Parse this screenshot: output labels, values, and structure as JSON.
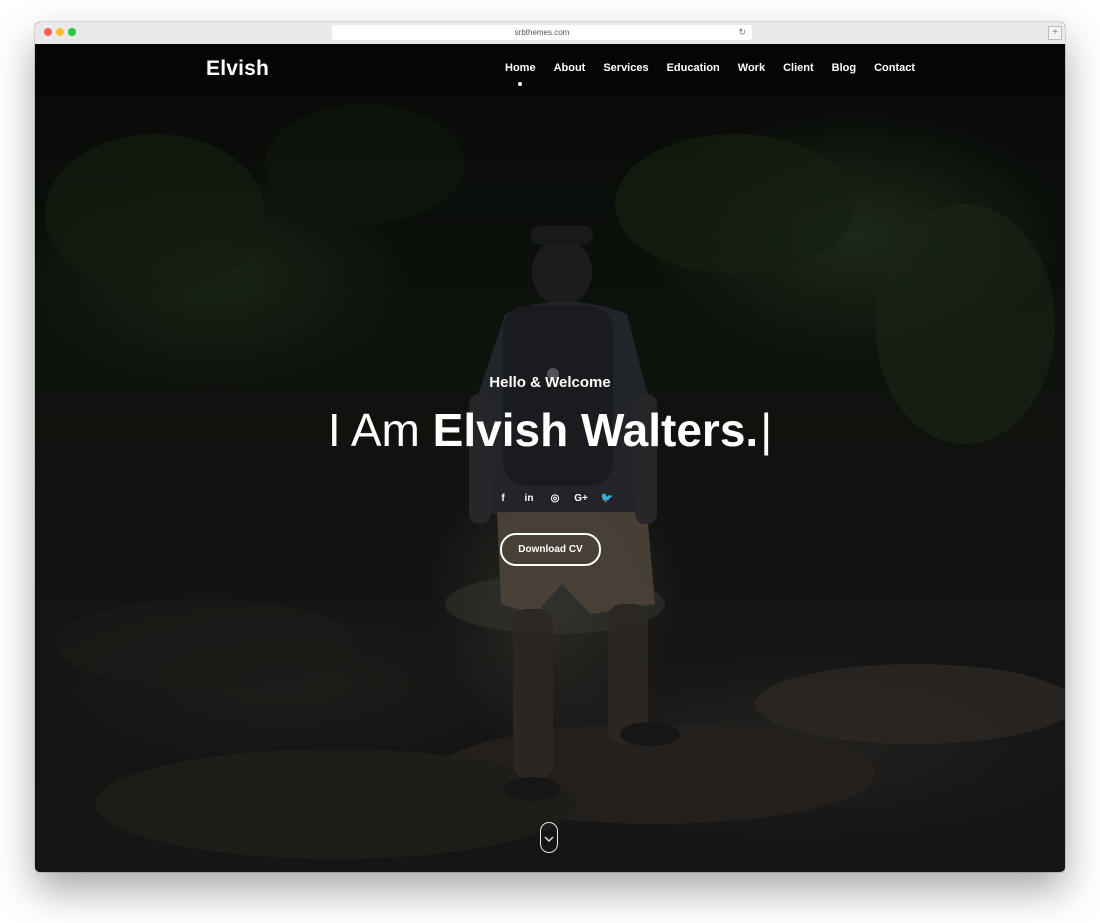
{
  "browser": {
    "url": "srbthemes.com"
  },
  "header": {
    "logo": "Elvish",
    "nav": [
      {
        "label": "Home",
        "active": true
      },
      {
        "label": "About"
      },
      {
        "label": "Services"
      },
      {
        "label": "Education"
      },
      {
        "label": "Work"
      },
      {
        "label": "Client"
      },
      {
        "label": "Blog"
      },
      {
        "label": "Contact"
      }
    ]
  },
  "hero": {
    "greeting": "Hello & Welcome",
    "headline_light": "I Am ",
    "headline_bold": "Elvish Walters.",
    "caret": "|",
    "social_icons": [
      {
        "name": "facebook-icon",
        "glyph": "f"
      },
      {
        "name": "linkedin-icon",
        "glyph": "in"
      },
      {
        "name": "dribbble-icon",
        "glyph": "◎"
      },
      {
        "name": "google-plus-icon",
        "glyph": "G+"
      },
      {
        "name": "twitter-icon",
        "glyph": "🐦"
      }
    ],
    "cta_label": "Download CV"
  },
  "colors": {
    "text": "#ffffff",
    "overlay": "#000000"
  }
}
